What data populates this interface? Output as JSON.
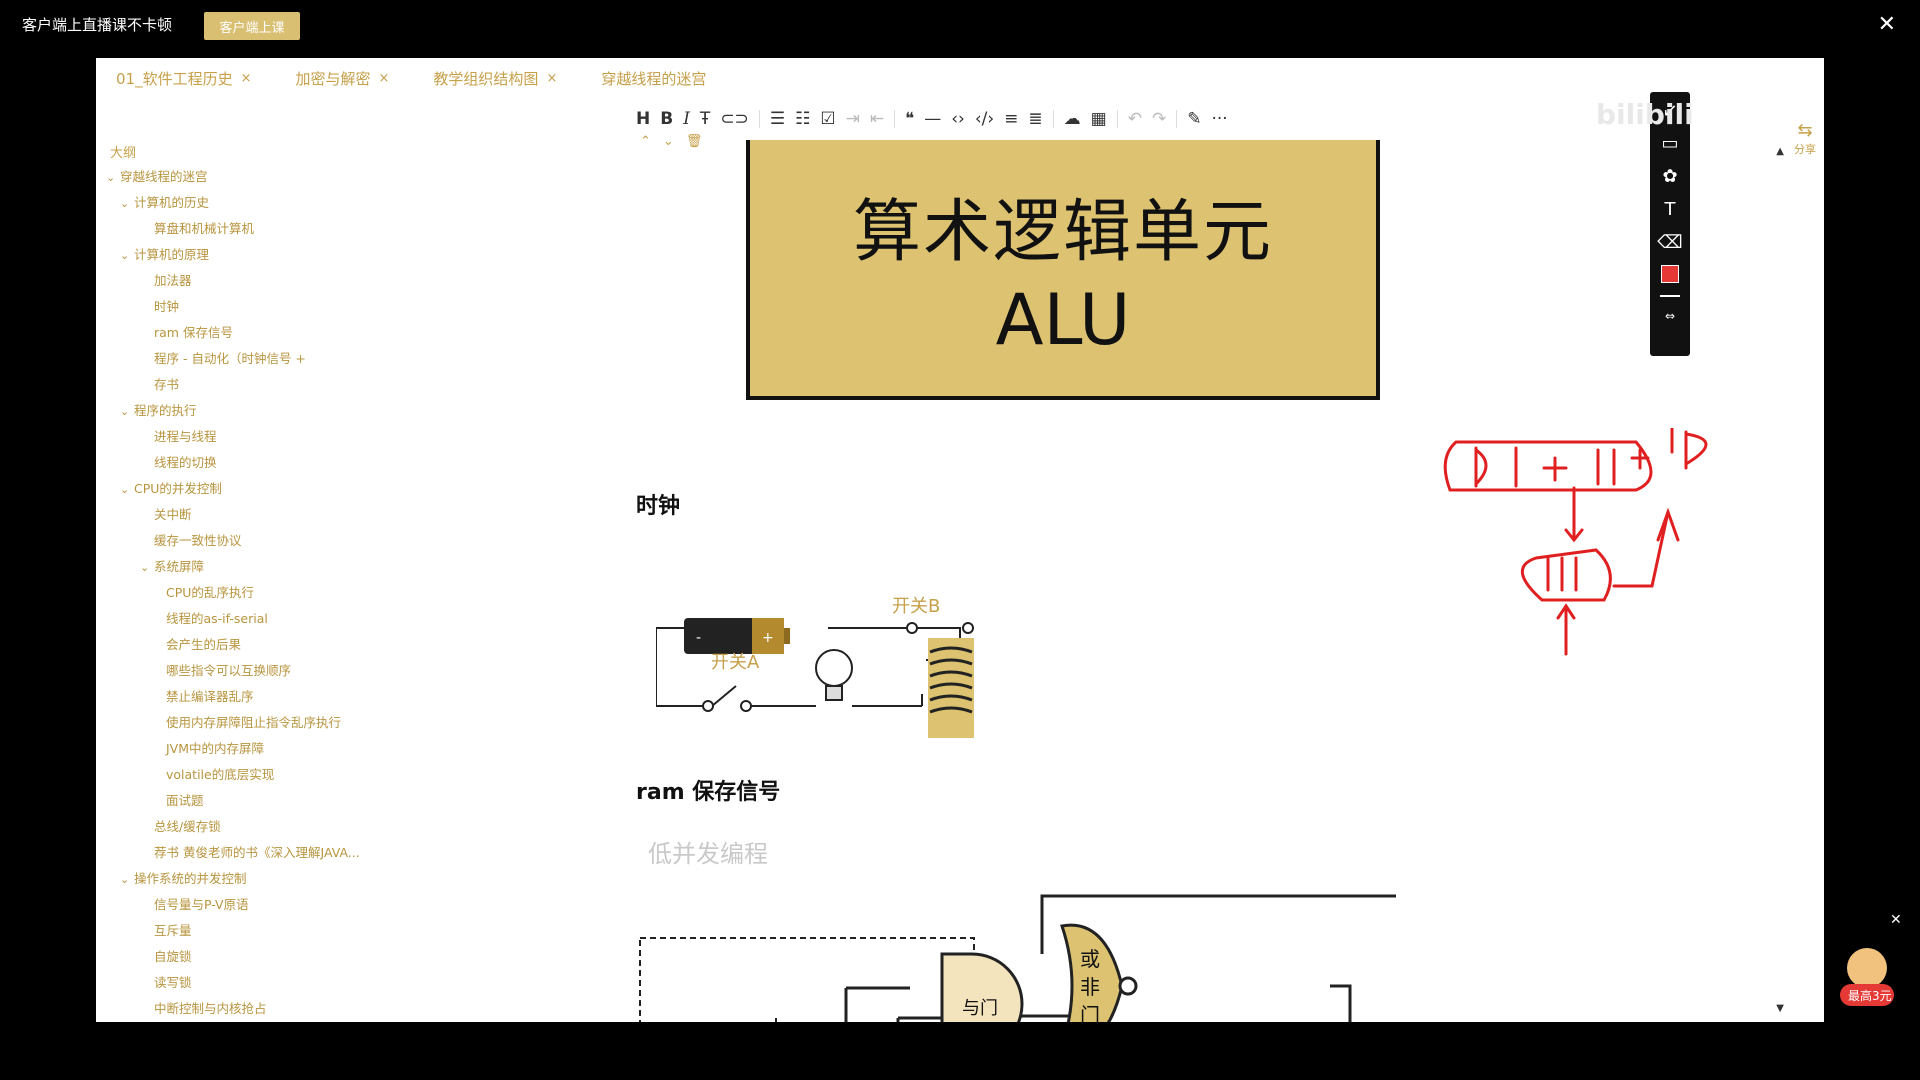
{
  "topbar": {
    "title": "客户端上直播课不卡顿",
    "live_button": "客户端上课",
    "close": "✕"
  },
  "tabs": [
    {
      "label": "01_软件工程历史"
    },
    {
      "label": "加密与解密"
    },
    {
      "label": "教学组织结构图"
    },
    {
      "label": "穿越线程的迷宫"
    }
  ],
  "outline": {
    "heading": "大纲",
    "items": [
      {
        "label": "穿越线程的迷宫",
        "level": 0,
        "expanded": true
      },
      {
        "label": "计算机的历史",
        "level": 1,
        "expanded": true
      },
      {
        "label": "算盘和机械计算机",
        "level": 2
      },
      {
        "label": "计算机的原理",
        "level": 1,
        "expanded": true
      },
      {
        "label": "加法器",
        "level": 2
      },
      {
        "label": "时钟",
        "level": 2
      },
      {
        "label": "ram 保存信号",
        "level": 2
      },
      {
        "label": "程序 - 自动化（时钟信号 +",
        "level": 2
      },
      {
        "label": "存书",
        "level": 2
      },
      {
        "label": "程序的执行",
        "level": 1,
        "expanded": true
      },
      {
        "label": "进程与线程",
        "level": 2
      },
      {
        "label": "线程的切换",
        "level": 2
      },
      {
        "label": "CPU的并发控制",
        "level": 1,
        "expanded": true
      },
      {
        "label": "关中断",
        "level": 2
      },
      {
        "label": "缓存一致性协议",
        "level": 2
      },
      {
        "label": "系统屏障",
        "level": 2,
        "expanded": true
      },
      {
        "label": "CPU的乱序执行",
        "level": 3
      },
      {
        "label": "线程的as-if-serial",
        "level": 3
      },
      {
        "label": "会产生的后果",
        "level": 3
      },
      {
        "label": "哪些指令可以互换顺序",
        "level": 3
      },
      {
        "label": "禁止编译器乱序",
        "level": 3
      },
      {
        "label": "使用内存屏障阻止指令乱序执行",
        "level": 3
      },
      {
        "label": "JVM中的内存屏障",
        "level": 3
      },
      {
        "label": "volatile的底层实现",
        "level": 3
      },
      {
        "label": "面试题",
        "level": 3
      },
      {
        "label": "总线/缓存锁",
        "level": 2
      },
      {
        "label": "荐书 黄俊老师的书《深入理解JAVA...",
        "level": 2
      },
      {
        "label": "操作系统的并发控制",
        "level": 1,
        "expanded": true
      },
      {
        "label": "信号量与P-V原语",
        "level": 2
      },
      {
        "label": "互斥量",
        "level": 2
      },
      {
        "label": "自旋锁",
        "level": 2
      },
      {
        "label": "读写锁",
        "level": 2
      },
      {
        "label": "中断控制与内核抢占",
        "level": 2
      }
    ]
  },
  "toolbar": {
    "heading": "H",
    "bold": "B",
    "italic": "I",
    "strike": "干",
    "more": "···"
  },
  "content": {
    "alu_title_cn": "算术逻辑单元",
    "alu_title_en": "ALU",
    "clock_heading": "时钟",
    "switch_b": "开关B",
    "switch_a": "开关A",
    "battery_minus": "-",
    "battery_plus": "+",
    "ram_heading": "ram 保存信号",
    "ram_watermark": "低并发编程",
    "and_gate": "与门",
    "nor_gate_1": "或",
    "nor_gate_2": "非",
    "nor_gate_3": "门"
  },
  "sidebar_right": {
    "share": "分享",
    "brand": "bilibili"
  },
  "promo": {
    "label": "最高3元"
  },
  "colors": {
    "accent": "#c7a04a",
    "alu_fill": "#dcc271",
    "annotation": "#e02020"
  }
}
